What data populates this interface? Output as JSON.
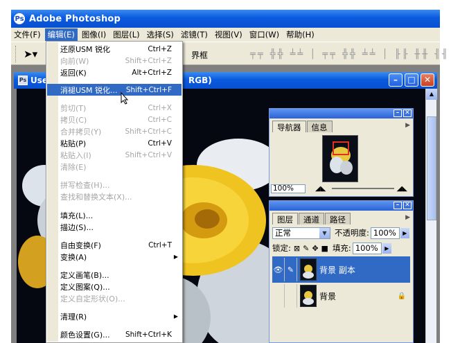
{
  "app": {
    "title": "Adobe Photoshop",
    "icon": "photoshop-app-icon"
  },
  "menubar": [
    {
      "label": "文件(F)"
    },
    {
      "label": "编辑(E)",
      "active": true
    },
    {
      "label": "图像(I)"
    },
    {
      "label": "图层(L)"
    },
    {
      "label": "选择(S)"
    },
    {
      "label": "滤镜(T)"
    },
    {
      "label": "视图(V)"
    },
    {
      "label": "窗口(W)"
    },
    {
      "label": "帮助(H)"
    }
  ],
  "toolbar": {
    "tool_icon": "move-tool-icon",
    "bounds_label": "界框"
  },
  "document": {
    "title": "Use",
    "mode": "RGB)"
  },
  "edit_menu": {
    "items": [
      {
        "label": "还原USM 锐化",
        "shortcut": "Ctrl+Z",
        "disabled": false
      },
      {
        "label": "向前(W)",
        "shortcut": "Shift+Ctrl+Z",
        "disabled": true
      },
      {
        "label": "返回(K)",
        "shortcut": "Alt+Ctrl+Z",
        "disabled": false
      },
      {
        "label": "消褪USM 锐化...",
        "shortcut": "Shift+Ctrl+F",
        "disabled": false,
        "selected": true
      },
      {
        "label": "剪切(T)",
        "shortcut": "Ctrl+X",
        "disabled": true
      },
      {
        "label": "拷贝(C)",
        "shortcut": "Ctrl+C",
        "disabled": true
      },
      {
        "label": "合并拷贝(Y)",
        "shortcut": "Shift+Ctrl+C",
        "disabled": true
      },
      {
        "label": "粘贴(P)",
        "shortcut": "Ctrl+V",
        "disabled": false
      },
      {
        "label": "粘贴入(I)",
        "shortcut": "Shift+Ctrl+V",
        "disabled": true
      },
      {
        "label": "清除(E)",
        "shortcut": "",
        "disabled": true
      },
      {
        "label": "拼写检查(H)...",
        "shortcut": "",
        "disabled": true
      },
      {
        "label": "查找和替换文本(X)...",
        "shortcut": "",
        "disabled": true
      },
      {
        "label": "填充(L)...",
        "shortcut": "",
        "disabled": false
      },
      {
        "label": "描边(S)...",
        "shortcut": "",
        "disabled": false
      },
      {
        "label": "自由变换(F)",
        "shortcut": "Ctrl+T",
        "disabled": false
      },
      {
        "label": "变换(A)",
        "shortcut": "",
        "disabled": false,
        "submenu": true
      },
      {
        "label": "定义画笔(B)...",
        "shortcut": "",
        "disabled": false
      },
      {
        "label": "定义图案(Q)...",
        "shortcut": "",
        "disabled": false
      },
      {
        "label": "定义自定形状(O)...",
        "shortcut": "",
        "disabled": true
      },
      {
        "label": "清理(R)",
        "shortcut": "",
        "disabled": false,
        "submenu": true
      },
      {
        "label": "颜色设置(G)...",
        "shortcut": "Shift+Ctrl+K",
        "disabled": false
      }
    ]
  },
  "navigator_panel": {
    "tabs": [
      "导航器",
      "信息"
    ],
    "zoom": "100%"
  },
  "layers_panel": {
    "tabs": [
      "图层",
      "通道",
      "路径"
    ],
    "blend_mode": "正常",
    "opacity_label": "不透明度:",
    "opacity": "100%",
    "lock_label": "锁定:",
    "fill_label": "填充:",
    "fill": "100%",
    "layers": [
      {
        "name": "背景 副本",
        "visible": true,
        "selected": true,
        "locked": false
      },
      {
        "name": "背景",
        "visible": false,
        "selected": false,
        "locked": true
      }
    ]
  },
  "colors": {
    "xp_blue": "#0a5ae0",
    "selection": "#316ac5",
    "chrome": "#ece9d8"
  }
}
